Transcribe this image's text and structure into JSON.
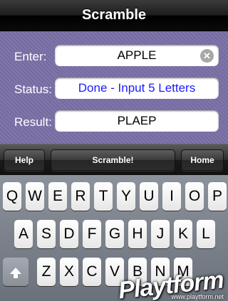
{
  "navbar": {
    "title": "Scramble"
  },
  "form": {
    "enter": {
      "label": "Enter:",
      "value": "APPLE"
    },
    "status": {
      "label": "Status:",
      "value": "Done - Input 5 Letters"
    },
    "result": {
      "label": "Result:",
      "value": "PLAEP"
    }
  },
  "toolbar": {
    "help": "Help",
    "scramble": "Scramble!",
    "home": "Home"
  },
  "keyboard": {
    "row1": [
      "Q",
      "W",
      "E",
      "R",
      "T",
      "Y",
      "U",
      "I",
      "O",
      "P"
    ],
    "row2": [
      "A",
      "S",
      "D",
      "F",
      "G",
      "H",
      "J",
      "K",
      "L"
    ],
    "row3": [
      "Z",
      "X",
      "C",
      "V",
      "B",
      "N",
      "M"
    ]
  },
  "watermark": {
    "brand": "Playtform",
    "url": "www.playtform.net"
  },
  "colors": {
    "form_background": "#7a6fa6",
    "status_text": "#1a1aff"
  }
}
